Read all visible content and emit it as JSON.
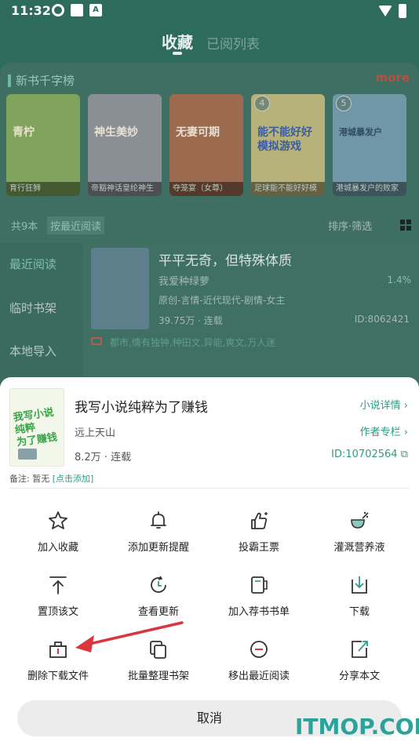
{
  "status": {
    "time": "11:32"
  },
  "top_tabs": {
    "favorites": "收藏",
    "read_list": "已阅列表"
  },
  "rank": {
    "title": "新书千字榜",
    "more": "more",
    "books": [
      {
        "rank": "",
        "caption": "育行狂狮",
        "cover_text": "青柠"
      },
      {
        "rank": "",
        "caption": "帝豁神话皇纶神生",
        "cover_text": "神生美妙"
      },
      {
        "rank": "",
        "caption": "夺笼宴（女尊）",
        "cover_text": "无妻可期"
      },
      {
        "rank": "4",
        "caption": "足球能不能好好模",
        "cover_text": "能不能好好 模拟游戏"
      },
      {
        "rank": "5",
        "caption": "港城暴发户的败家",
        "cover_text": "港城暴发户"
      }
    ]
  },
  "filter": {
    "count": "共9本",
    "sort_recent": "按最近阅读",
    "sort_filter": "排序·筛选"
  },
  "side_nav": {
    "recent": "最近阅读",
    "temp_shelf": "临时书架",
    "local_import": "本地导入"
  },
  "book_main": {
    "title": "平平无奇，但特殊体质",
    "author": "我爱种绿萝",
    "progress": "1.4%",
    "tags": "原创-言情-近代现代-剧情-女主",
    "words": "39.75万 · 连载",
    "id": "ID:8062421",
    "labels": "都市,情有独钟,种田文,异能,爽文,万人迷"
  },
  "sheet": {
    "title": "我写小说纯粹为了赚钱",
    "author": "远上天山",
    "stats": "8.2万 · 连载",
    "detail_link": "小说详情",
    "author_column_link": "作者专栏",
    "id": "ID:10702564",
    "note_label": "备注: 暂无",
    "note_link": "[点击添加]",
    "actions": [
      {
        "label": "加入收藏",
        "icon": "star-icon"
      },
      {
        "label": "添加更新提醒",
        "icon": "bell-icon"
      },
      {
        "label": "投霸王票",
        "icon": "thumbs-up-icon"
      },
      {
        "label": "灌溉营养液",
        "icon": "watering-icon"
      },
      {
        "label": "置顶该文",
        "icon": "pin-top-icon"
      },
      {
        "label": "查看更新",
        "icon": "refresh-icon"
      },
      {
        "label": "加入荐书书单",
        "icon": "booklist-icon"
      },
      {
        "label": "下载",
        "icon": "download-icon"
      },
      {
        "label": "删除下载文件",
        "icon": "delete-download-icon"
      },
      {
        "label": "批量整理书架",
        "icon": "batch-shelf-icon"
      },
      {
        "label": "移出最近阅读",
        "icon": "remove-recent-icon"
      },
      {
        "label": "分享本文",
        "icon": "share-icon"
      }
    ],
    "cancel": "取消"
  },
  "watermark": "ITMOP.COM",
  "colors": {
    "accent": "#2e9b85",
    "arrow": "#d9363e"
  }
}
